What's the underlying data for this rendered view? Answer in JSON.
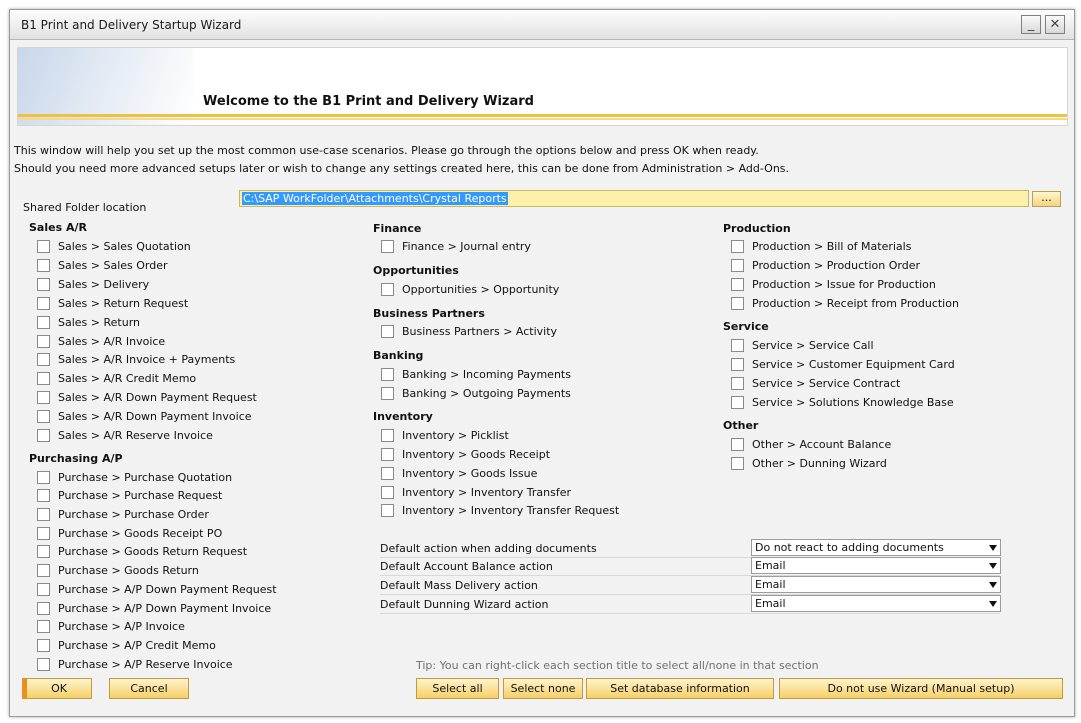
{
  "window": {
    "title": "B1 Print and Delivery Startup Wizard",
    "minimize_glyph": "_",
    "close_glyph": "✕"
  },
  "banner": {
    "title": "Welcome to the B1 Print and Delivery Wizard"
  },
  "intro": {
    "line1": "This window will help you set up the most common use-case scenarios. Please go through the options below and press OK when ready.",
    "line2": "Should you need more advanced setups later or wish to change any settings created here, this can be done from Administration > Add-Ons."
  },
  "shared_folder": {
    "label": "Shared Folder location",
    "value": "C:\\SAP WorkFolder\\Attachments\\Crystal Reports",
    "browse_label": "..."
  },
  "sections": {
    "sales": {
      "title": "Sales A/R",
      "items": [
        "Sales > Sales Quotation",
        "Sales > Sales Order",
        "Sales > Delivery",
        "Sales > Return Request",
        "Sales > Return",
        "Sales > A/R Invoice",
        "Sales > A/R Invoice + Payments",
        "Sales > A/R Credit Memo",
        "Sales > A/R Down Payment Request",
        "Sales > A/R Down Payment Invoice",
        "Sales > A/R Reserve Invoice"
      ]
    },
    "purchasing": {
      "title": "Purchasing A/P",
      "items": [
        "Purchase > Purchase Quotation",
        "Purchase > Purchase Request",
        "Purchase > Purchase Order",
        "Purchase > Goods Receipt PO",
        "Purchase > Goods Return Request",
        "Purchase > Goods Return",
        "Purchase > A/P Down Payment Request",
        "Purchase > A/P Down Payment Invoice",
        "Purchase > A/P Invoice",
        "Purchase > A/P Credit Memo",
        "Purchase > A/P Reserve Invoice"
      ]
    },
    "finance": {
      "title": "Finance",
      "items": [
        "Finance > Journal entry"
      ]
    },
    "opportunities": {
      "title": "Opportunities",
      "items": [
        "Opportunities > Opportunity"
      ]
    },
    "business_partners": {
      "title": "Business Partners",
      "items": [
        "Business Partners > Activity"
      ]
    },
    "banking": {
      "title": "Banking",
      "items": [
        "Banking > Incoming Payments",
        "Banking > Outgoing Payments"
      ]
    },
    "inventory": {
      "title": "Inventory",
      "items": [
        "Inventory > Picklist",
        "Inventory > Goods Receipt",
        "Inventory > Goods Issue",
        "Inventory > Inventory Transfer",
        "Inventory > Inventory Transfer Request"
      ]
    },
    "production": {
      "title": "Production",
      "items": [
        "Production > Bill of Materials",
        "Production > Production Order",
        "Production > Issue for Production",
        "Production > Receipt from Production"
      ]
    },
    "service": {
      "title": "Service",
      "items": [
        "Service > Service Call",
        "Service > Customer Equipment Card",
        "Service > Service Contract",
        "Service > Solutions Knowledge Base"
      ]
    },
    "other": {
      "title": "Other",
      "items": [
        "Other > Account Balance",
        "Other > Dunning Wizard"
      ]
    }
  },
  "defaults": [
    {
      "label": "Default action when adding documents",
      "value": "Do not react to adding documents"
    },
    {
      "label": "Default Account Balance action",
      "value": "Email"
    },
    {
      "label": "Default Mass Delivery action",
      "value": "Email"
    },
    {
      "label": "Default Dunning Wizard action",
      "value": "Email"
    }
  ],
  "tip": "Tip: You can right-click each section title to select all/none in that section",
  "buttons": {
    "ok": "OK",
    "cancel": "Cancel",
    "select_all": "Select all",
    "select_none": "Select none",
    "set_db_info": "Set database information",
    "manual_setup": "Do not use Wizard (Manual setup)"
  },
  "colors": {
    "accent_yellow": "#f6cf67",
    "ok_accent": "#e8901c",
    "field_highlight": "#fdf0a9",
    "selection_blue": "#3399ff"
  }
}
